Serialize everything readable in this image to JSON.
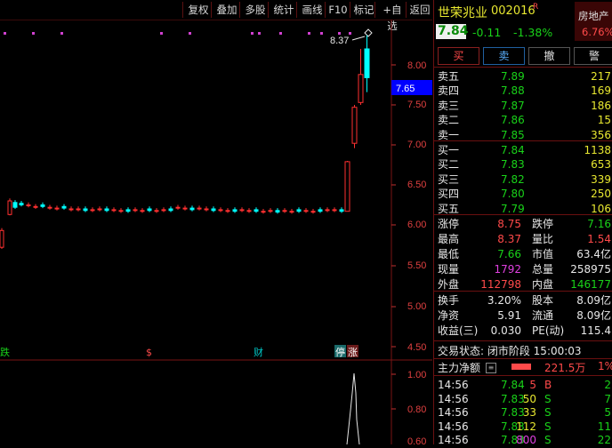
{
  "toolbar": {
    "items": [
      "复权",
      "叠加",
      "多股",
      "统计",
      "画线",
      "F10",
      "标记",
      "+自选",
      "返回"
    ]
  },
  "chart": {
    "price_axis": [
      "8.00",
      "7.50",
      "7.00",
      "6.50",
      "6.00",
      "5.50",
      "5.00",
      "4.50"
    ],
    "current_price_tag": "7.65",
    "high_label": "8.37",
    "event_markers": [
      "跌",
      "$",
      "财",
      "停",
      "涨"
    ],
    "volume_axis": [
      "1.00",
      "0.80",
      "0.60"
    ]
  },
  "stock": {
    "name": "世荣兆业",
    "code": "002016",
    "badge": "R",
    "price": "7.84",
    "change": "-0.11",
    "pct": "-1.38%",
    "industry": "房地产",
    "industry_pct": "6.76%"
  },
  "actions": [
    "买",
    "卖",
    "撤",
    "警"
  ],
  "asks": [
    {
      "label": "卖五",
      "price": "7.89",
      "vol": "217"
    },
    {
      "label": "卖四",
      "price": "7.88",
      "vol": "169"
    },
    {
      "label": "卖三",
      "price": "7.87",
      "vol": "186"
    },
    {
      "label": "卖二",
      "price": "7.86",
      "vol": "15"
    },
    {
      "label": "卖一",
      "price": "7.85",
      "vol": "356"
    }
  ],
  "bids": [
    {
      "label": "买一",
      "price": "7.84",
      "vol": "1138"
    },
    {
      "label": "买二",
      "price": "7.83",
      "vol": "653"
    },
    {
      "label": "买三",
      "price": "7.82",
      "vol": "339"
    },
    {
      "label": "买四",
      "price": "7.80",
      "vol": "250"
    },
    {
      "label": "买五",
      "price": "7.79",
      "vol": "106"
    }
  ],
  "stats": [
    {
      "l1": "涨停",
      "v1": "8.75",
      "l2": "跌停",
      "v2": "7.16"
    },
    {
      "l1": "最高",
      "v1": "8.37",
      "l2": "量比",
      "v2": "1.54"
    },
    {
      "l1": "最低",
      "v1": "7.66",
      "l2": "市值",
      "v2": "63.4亿"
    },
    {
      "l1": "现量",
      "v1": "1792",
      "l2": "总量",
      "v2": "258975"
    },
    {
      "l1": "外盘",
      "v1": "112798",
      "l2": "内盘",
      "v2": "146177"
    }
  ],
  "fundamentals": [
    {
      "l1": "换手",
      "v1": "3.20%",
      "l2": "股本",
      "v2": "8.09亿"
    },
    {
      "l1": "净资",
      "v1": "5.91",
      "l2": "流通",
      "v2": "8.09亿"
    },
    {
      "l1": "收益(三)",
      "v1": "0.030",
      "l2": "PE(动)",
      "v2": "115.4"
    }
  ],
  "trade_status": "交易状态: 闭市阶段 15:00:03",
  "main_flow": {
    "label": "主力净额",
    "value": "221.5万",
    "pct": "1%"
  },
  "ticks": [
    {
      "time": "14:56",
      "price": "7.84",
      "vol": "5",
      "side": "B",
      "extra": "2"
    },
    {
      "time": "14:56",
      "price": "7.83",
      "vol": "50",
      "side": "S",
      "extra": "7"
    },
    {
      "time": "14:56",
      "price": "7.83",
      "vol": "33",
      "side": "S",
      "extra": "5"
    },
    {
      "time": "14:56",
      "price": "7.83",
      "vol": "112",
      "side": "S",
      "extra": "11"
    },
    {
      "time": "14:56",
      "price": "7.83",
      "vol": "800",
      "side": "S",
      "extra": "22"
    }
  ],
  "colors": {
    "up": "#ff4a4a",
    "down": "#19d219",
    "candle_down": "#00ffff",
    "bg": "#000000",
    "accent_blue": "#0000ff"
  }
}
